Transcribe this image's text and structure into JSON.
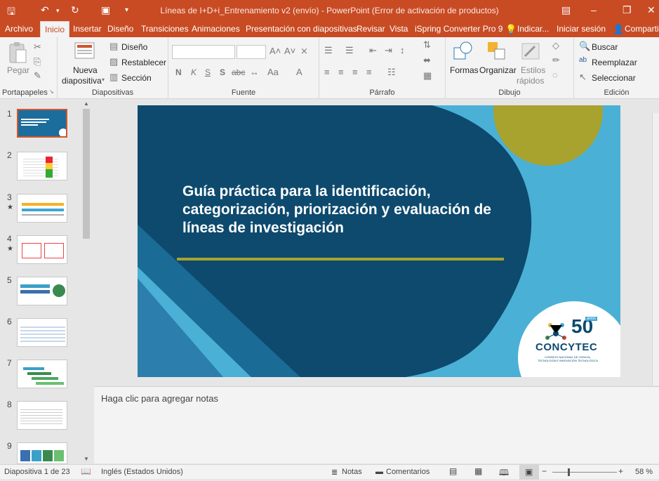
{
  "title_bar": {
    "window_title": "Líneas de I+D+i_Entrenamiento v2 (envío) - PowerPoint (Error de activación de productos)"
  },
  "tabs": [
    "Archivo",
    "Inicio",
    "Insertar",
    "Diseño",
    "Transiciones",
    "Animaciones",
    "Presentación con diapositivas",
    "Revisar",
    "Vista",
    "iSpring Converter Pro 9",
    "Indicar...",
    "Iniciar sesión",
    "Compartir"
  ],
  "ribbon": {
    "portapapeles": {
      "label": "Portapapeles",
      "pegar": "Pegar"
    },
    "diapositivas": {
      "label": "Diapositivas",
      "nueva_line1": "Nueva",
      "nueva_line2": "diapositiva",
      "diseno": "Diseño",
      "restablecer": "Restablecer",
      "seccion": "Sección"
    },
    "fuente": {
      "label": "Fuente",
      "bold": "N",
      "italic": "K",
      "underline": "S",
      "shadow": "S",
      "strike": "abc"
    },
    "parrafo": {
      "label": "Párrafo"
    },
    "dibujo": {
      "label": "Dibujo",
      "formas": "Formas",
      "organizar": "Organizar",
      "estilos_line1": "Estilos",
      "estilos_line2": "rápidos"
    },
    "edicion": {
      "label": "Edición",
      "buscar": "Buscar",
      "reemplazar": "Reemplazar",
      "seleccionar": "Seleccionar"
    }
  },
  "thumbnails": {
    "numbers": [
      "1",
      "2",
      "3",
      "4",
      "5",
      "6",
      "7",
      "8",
      "9"
    ],
    "star": "★"
  },
  "slide": {
    "title": "Guía práctica para la identificación, categorización, priorización y evaluación de líneas de investigación",
    "logo_number": "50",
    "logo_badge": "años",
    "logo_name": "CONCYTEC",
    "logo_sub1": "CONSEJO NACIONAL DE CIENCIA,",
    "logo_sub2": "TECNOLOGÍA E INNOVACIÓN TECNOLÓGICA"
  },
  "notes": {
    "placeholder": "Haga clic para agregar notas"
  },
  "status": {
    "slide_count": "Diapositiva 1 de 23",
    "language": "Inglés (Estados Unidos)",
    "notes": "Notas",
    "comments": "Comentarios",
    "zoom": "58 %"
  },
  "colors": {
    "accent": "#c84b24",
    "slide_dark": "#0d4a6e",
    "slide_light": "#4ab0d6",
    "olive": "#a8a22f"
  }
}
